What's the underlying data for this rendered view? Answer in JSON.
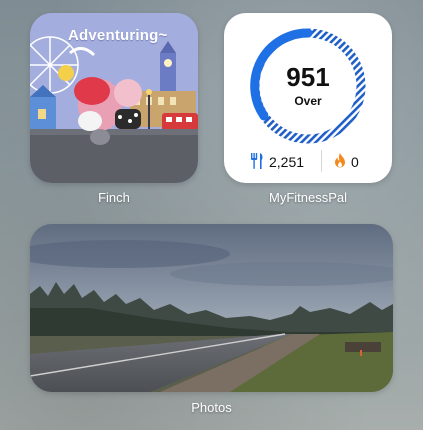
{
  "widgets": {
    "finch": {
      "label": "Finch",
      "banner": "Adventuring~"
    },
    "myfitnesspal": {
      "label": "MyFitnessPal",
      "calories_value": "951",
      "calories_status": "Over",
      "food_value": "2,251",
      "exercise_value": "0",
      "food_icon": "fork-knife-icon",
      "exercise_icon": "flame-icon",
      "accent": "#1f6fe5",
      "flame_color": "#f28a1e"
    },
    "photos": {
      "label": "Photos"
    }
  }
}
